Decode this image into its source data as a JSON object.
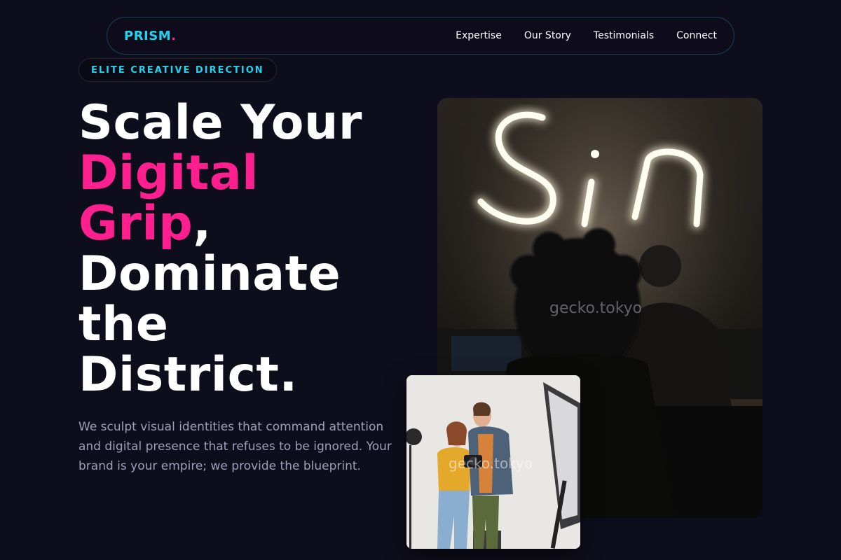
{
  "brand": {
    "name": "PRISM",
    "dot": "."
  },
  "nav": {
    "links": [
      "Expertise",
      "Our Story",
      "Testimonials",
      "Connect"
    ]
  },
  "hero": {
    "badge": "ELITE CREATIVE DIRECTION",
    "headline": {
      "line1": "Scale Your",
      "pink1": "Digital",
      "pink2": "Grip",
      "comma": ",",
      "line4": "Dominate",
      "line5": "the",
      "line6": "District."
    },
    "lead": "We sculpt visual identities that command attention and digital presence that refuses to be ignored. Your brand is your empire; we provide the blueprint."
  },
  "images": {
    "main_watermark": "gecko.tokyo",
    "secondary_watermark": "gecko.tokyo",
    "neon_sign": "Sin"
  },
  "colors": {
    "background": "#0e0d1b",
    "accent_cyan": "#22d3ee",
    "accent_pink": "#ff1f8e",
    "muted_text": "#9ea0b8"
  }
}
